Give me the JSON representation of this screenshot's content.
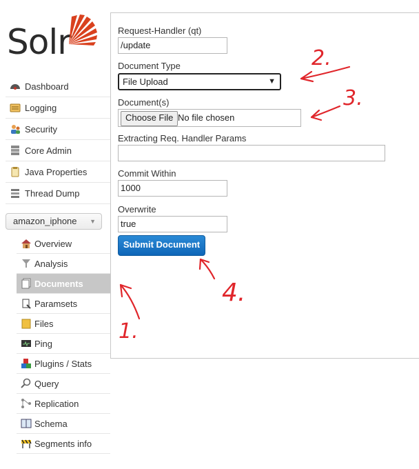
{
  "brand": {
    "name": "Solr",
    "accent": "#d9411e"
  },
  "nav": {
    "items": [
      {
        "label": "Dashboard",
        "icon": "dashboard-icon"
      },
      {
        "label": "Logging",
        "icon": "logging-icon"
      },
      {
        "label": "Security",
        "icon": "security-icon"
      },
      {
        "label": "Core Admin",
        "icon": "core-admin-icon"
      },
      {
        "label": "Java Properties",
        "icon": "java-properties-icon"
      },
      {
        "label": "Thread Dump",
        "icon": "thread-dump-icon"
      }
    ]
  },
  "core_selector": {
    "value": "amazon_iphone"
  },
  "core_menu": {
    "items": [
      {
        "label": "Overview",
        "icon": "overview-icon"
      },
      {
        "label": "Analysis",
        "icon": "analysis-icon"
      },
      {
        "label": "Documents",
        "icon": "documents-icon",
        "active": true
      },
      {
        "label": "Paramsets",
        "icon": "paramsets-icon"
      },
      {
        "label": "Files",
        "icon": "files-icon"
      },
      {
        "label": "Ping",
        "icon": "ping-icon"
      },
      {
        "label": "Plugins / Stats",
        "icon": "plugins-icon"
      },
      {
        "label": "Query",
        "icon": "query-icon"
      },
      {
        "label": "Replication",
        "icon": "replication-icon"
      },
      {
        "label": "Schema",
        "icon": "schema-icon"
      },
      {
        "label": "Segments info",
        "icon": "segments-icon"
      }
    ]
  },
  "form": {
    "request_handler": {
      "label": "Request-Handler (qt)",
      "value": "/update"
    },
    "document_type": {
      "label": "Document Type",
      "value": "File Upload"
    },
    "documents": {
      "label": "Document(s)",
      "button": "Choose File",
      "status": "No file chosen"
    },
    "extracting_params": {
      "label": "Extracting Req. Handler Params",
      "value": ""
    },
    "commit_within": {
      "label": "Commit Within",
      "value": "1000"
    },
    "overwrite": {
      "label": "Overwrite",
      "value": "true"
    },
    "submit_label": "Submit Document"
  },
  "annotations": {
    "color": "#e0262b",
    "numbers": [
      "1.",
      "2.",
      "3.",
      "4."
    ]
  }
}
